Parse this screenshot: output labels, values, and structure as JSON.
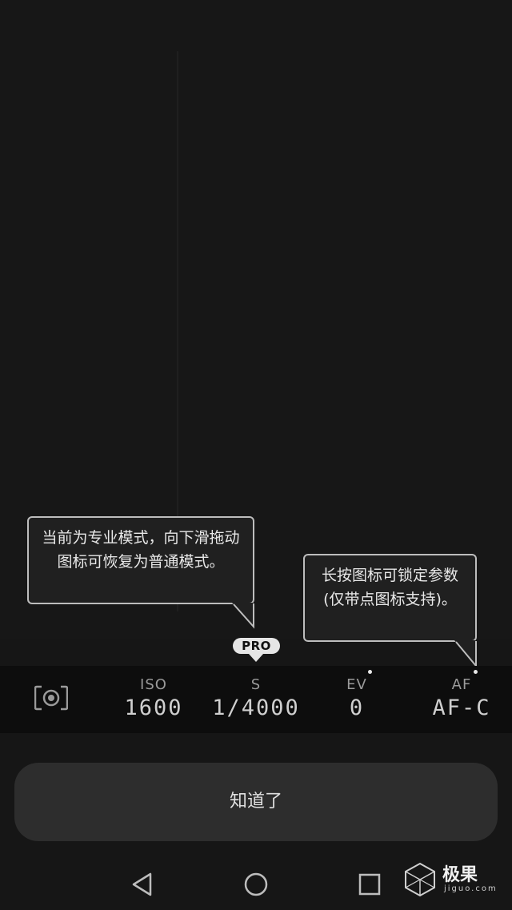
{
  "tooltips": {
    "pro_mode": "当前为专业模式，向下滑拖动图标可恢复为普通模式。",
    "lock": "长按图标可锁定参数 (仅带点图标支持)。"
  },
  "pro_badge": "PRO",
  "params": {
    "metering_icon": "metering-icon",
    "iso": {
      "label": "ISO",
      "value": "1600"
    },
    "shutter": {
      "label": "S",
      "value": "1/4000"
    },
    "ev": {
      "label": "EV",
      "value": "0"
    },
    "af": {
      "label": "AF",
      "value": "AF-C"
    }
  },
  "got_it_button": "知道了",
  "nav": {
    "back_icon": "back-triangle-icon",
    "home_icon": "home-circle-icon",
    "recent_icon": "recent-square-icon"
  },
  "watermark": {
    "logo": "极果",
    "sub": "jiguo.com"
  }
}
